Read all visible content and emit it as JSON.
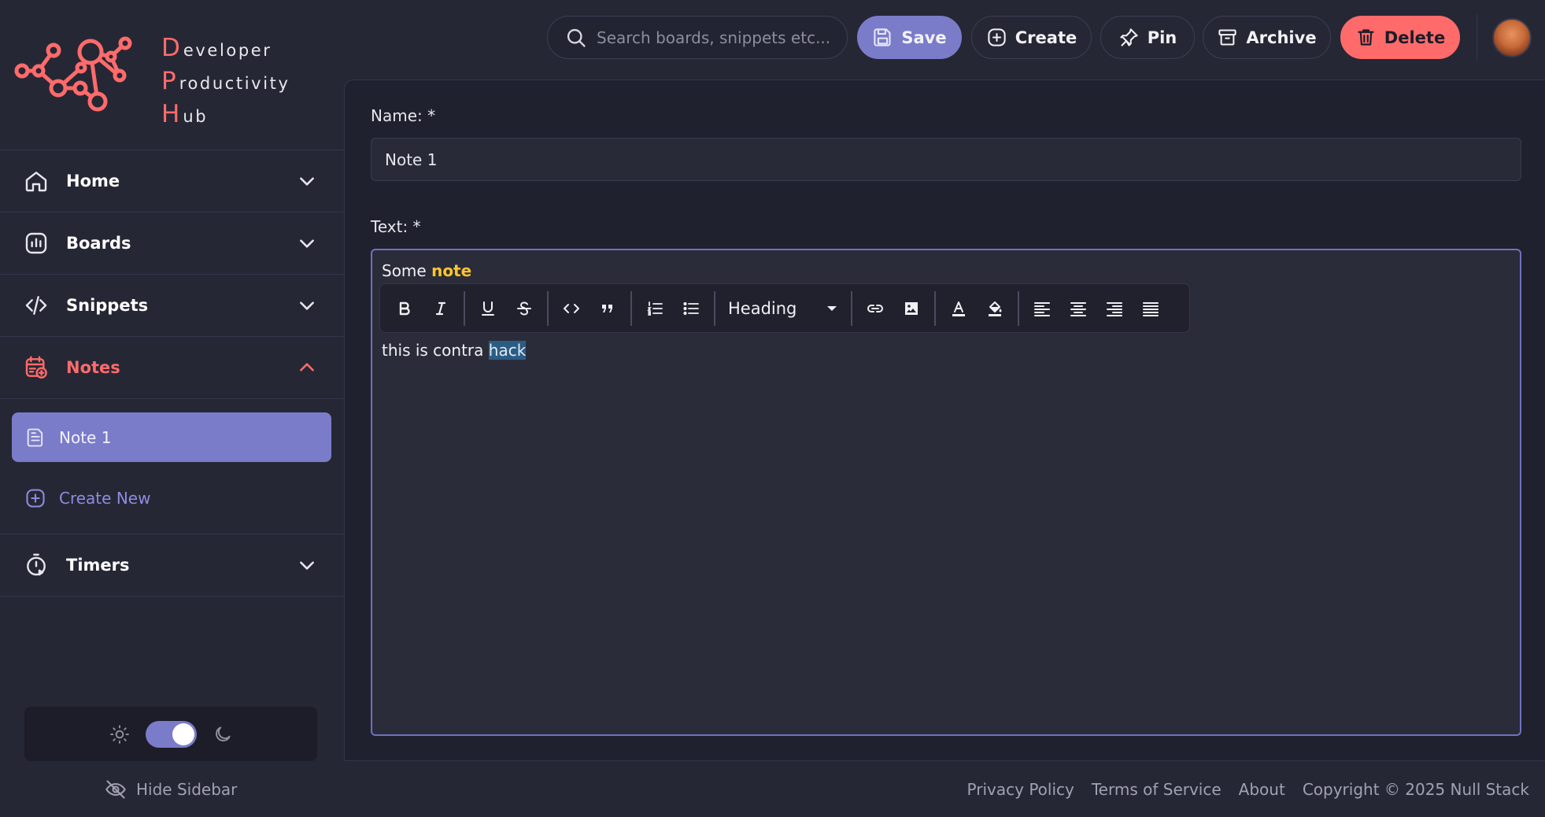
{
  "brand": {
    "line1_cap": "D",
    "line1_rest": "eveloper",
    "line2_cap": "P",
    "line2_rest": "roductivity",
    "line3_cap": "H",
    "line3_rest": "ub",
    "accent_color": "#ff6b6b"
  },
  "sidebar": {
    "items": [
      {
        "label": "Home",
        "icon": "home-icon",
        "expanded": false
      },
      {
        "label": "Boards",
        "icon": "chart-icon",
        "expanded": false
      },
      {
        "label": "Snippets",
        "icon": "code-icon",
        "expanded": false
      },
      {
        "label": "Notes",
        "icon": "calendar-note-icon",
        "expanded": true
      },
      {
        "label": "Timers",
        "icon": "timer-icon",
        "expanded": false
      }
    ],
    "notes_children": {
      "note_label": "Note 1",
      "create_label": "Create New"
    },
    "theme": {
      "mode": "dark",
      "toggle_on": true
    },
    "hide_label": "Hide Sidebar"
  },
  "topbar": {
    "search_placeholder": "Search boards, snippets etc...",
    "save_label": "Save",
    "create_label": "Create",
    "pin_label": "Pin",
    "archive_label": "Archive",
    "delete_label": "Delete"
  },
  "form": {
    "name_label": "Name: *",
    "name_value": "Note 1",
    "text_label": "Text: *",
    "content_line1_plain": "Some ",
    "content_line1_highlight": "note",
    "content_line2_plain": "this is contra ",
    "content_line2_selected": "hack",
    "heading_select": "Heading"
  },
  "footer": {
    "privacy": "Privacy Policy",
    "terms": "Terms of Service",
    "about": "About",
    "copyright": "Copyright © 2025 Null Stack"
  },
  "colors": {
    "primary": "#7b7cc9",
    "danger": "#ff6b6b",
    "highlight_text": "#ffc42e",
    "selection": "#2b5d84"
  }
}
